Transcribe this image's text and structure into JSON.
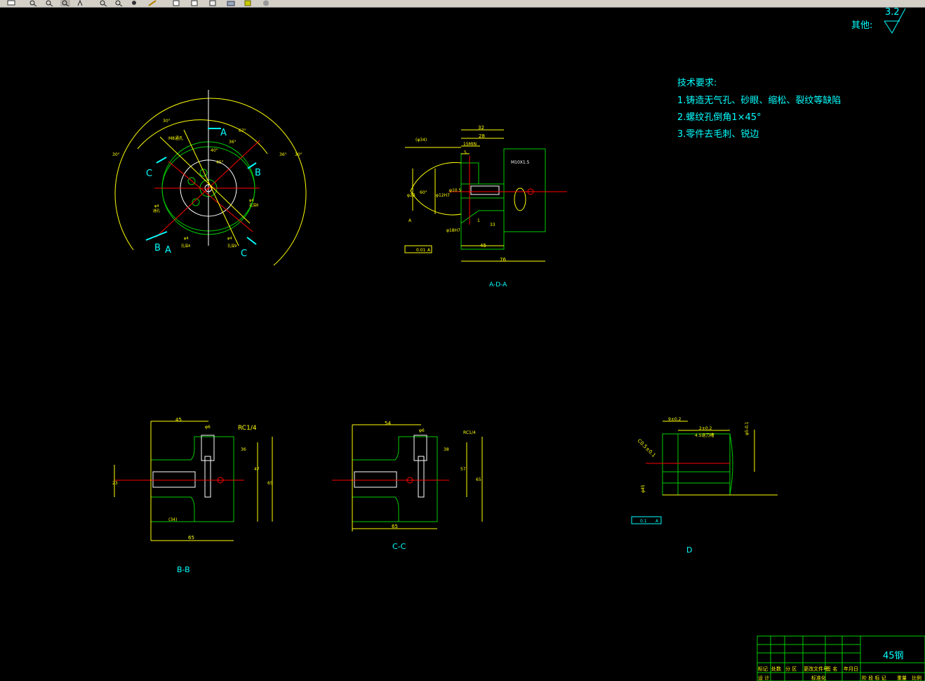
{
  "toolbar": {
    "buttons": [
      {
        "name": "print-icon"
      },
      {
        "name": "zoom-realtime-icon"
      },
      {
        "name": "zoom-window-icon"
      },
      {
        "name": "zoom-previous-icon"
      },
      {
        "name": "pan-icon"
      },
      {
        "name": "zoom-in-icon"
      },
      {
        "name": "zoom-out-icon"
      },
      {
        "name": "zoom-extents-icon"
      },
      {
        "name": "match-properties-icon"
      },
      {
        "name": "copy-icon"
      },
      {
        "name": "paste-icon"
      },
      {
        "name": "properties-icon"
      },
      {
        "name": "design-center-icon"
      },
      {
        "name": "layer-icon"
      },
      {
        "name": "help-icon"
      }
    ]
  },
  "colors": {
    "background": "#000000",
    "yellow": "#ffff00",
    "green": "#00cc00",
    "cyan": "#00ffff",
    "red": "#ff0000",
    "white": "#ffffff",
    "blue": "#4d6bff",
    "magenta": "#ff00ff"
  },
  "drawing": {
    "roughness": {
      "value": "3.2",
      "label": "其他:"
    },
    "tech_req": {
      "title": "技术要求:",
      "items": [
        "1.铸造无气孔、砂眼、缩松、裂纹等缺陷",
        "2.螺纹孔倒角1×45°",
        "3.零件去毛刺、锐边"
      ]
    },
    "top_view": {
      "labels": {
        "A1": "A",
        "B1": "B",
        "C1": "C",
        "A2": "A",
        "B2": "B",
        "C2": "C"
      },
      "dims": {
        "d1": "67°",
        "d2": "36°",
        "d3": "30°",
        "d4": "30°",
        "d5": "36°",
        "d6": "45°",
        "d7": "30°",
        "d8": "40°"
      },
      "notes": {
        "n1": "M8通孔",
        "n2": "φ4",
        "n3": "通孔",
        "n4": "φ4",
        "n5": "孔深8",
        "n6": "φ4",
        "n7": "孔深4",
        "n8": "φ4",
        "n9": "孔深9"
      }
    },
    "section_ada": {
      "title": "A-D-A",
      "dims": {
        "d32": "32",
        "d28": "28",
        "d15": "15MIN",
        "d5": "5",
        "dm": "M10X1.5",
        "d34": "(φ34)",
        "d45": "45",
        "d76": "76",
        "d60": "60°",
        "dphi12": "φ12H7",
        "dphi5": "φ10.5",
        "d1": "1",
        "d33": "33",
        "dphi20": "φ20",
        "tol": "0.01",
        "datum": "A",
        "datumA": "A",
        "dphi18": "φ18H7"
      }
    },
    "section_bb": {
      "title": "B-B",
      "dims": {
        "d45": "45",
        "d16": "φ6",
        "rc": "RC1/4",
        "d36": "36",
        "d47": "47",
        "d65": "65",
        "d23": "23",
        "d34": "(34)",
        "d65b": "65"
      }
    },
    "section_cc": {
      "title": "C-C",
      "dims": {
        "d54": "54",
        "d16": "φ6",
        "rc": "RC1/4",
        "d38": "38",
        "d57": "57",
        "d65": "65",
        "d65b": "65"
      }
    },
    "detail_d": {
      "title": "D",
      "dims": {
        "d9": "9±0.2",
        "d2": "2±0.2",
        "note": "4.5退刀槽",
        "ch": "C0.5±0.1",
        "tol": "0.1",
        "datum": "A",
        "v": "φ5-0.1",
        "dphi": "φ45"
      }
    },
    "title_block": {
      "material": "45钢",
      "row1": [
        "标记",
        "处数",
        "分 区",
        "更改文件号",
        "签 名",
        "年月日"
      ],
      "row2": [
        "设 计",
        "标准化",
        "",
        "",
        "",
        "",
        "阶 段 标 记",
        "重量",
        "比例"
      ]
    }
  }
}
